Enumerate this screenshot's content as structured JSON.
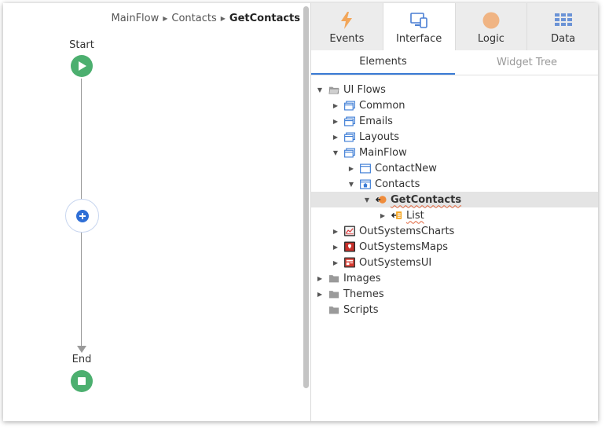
{
  "breadcrumb": {
    "items": [
      "MainFlow",
      "Contacts"
    ],
    "current": "GetContacts"
  },
  "flow": {
    "start_label": "Start",
    "end_label": "End"
  },
  "tabs": {
    "events": "Events",
    "interface": "Interface",
    "logic": "Logic",
    "data": "Data",
    "active": "Interface"
  },
  "subtabs": {
    "elements": "Elements",
    "widget_tree": "Widget Tree",
    "active": "Elements"
  },
  "tree": [
    {
      "label": "UI Flows",
      "depth": 0,
      "toggle": "expanded",
      "icon": "folder-open-icon"
    },
    {
      "label": "Common",
      "depth": 1,
      "toggle": "collapsed",
      "icon": "ui-flow-icon"
    },
    {
      "label": "Emails",
      "depth": 1,
      "toggle": "collapsed",
      "icon": "ui-flow-icon"
    },
    {
      "label": "Layouts",
      "depth": 1,
      "toggle": "collapsed",
      "icon": "ui-flow-icon"
    },
    {
      "label": "MainFlow",
      "depth": 1,
      "toggle": "expanded",
      "icon": "ui-flow-icon"
    },
    {
      "label": "ContactNew",
      "depth": 2,
      "toggle": "collapsed",
      "icon": "screen-icon"
    },
    {
      "label": "Contacts",
      "depth": 2,
      "toggle": "expanded",
      "icon": "home-screen-icon"
    },
    {
      "label": "GetContacts",
      "depth": 3,
      "toggle": "expanded",
      "icon": "data-action-icon",
      "selected": true
    },
    {
      "label": "List",
      "depth": 4,
      "toggle": "collapsed",
      "icon": "output-list-icon"
    },
    {
      "label": "OutSystemsCharts",
      "depth": 1,
      "toggle": "collapsed",
      "icon": "charts-module-icon"
    },
    {
      "label": "OutSystemsMaps",
      "depth": 1,
      "toggle": "collapsed",
      "icon": "maps-module-icon"
    },
    {
      "label": "OutSystemsUI",
      "depth": 1,
      "toggle": "collapsed",
      "icon": "ui-module-icon"
    },
    {
      "label": "Images",
      "depth": 0,
      "toggle": "collapsed",
      "icon": "folder-icon"
    },
    {
      "label": "Themes",
      "depth": 0,
      "toggle": "collapsed",
      "icon": "folder-icon"
    },
    {
      "label": "Scripts",
      "depth": 0,
      "toggle": "none",
      "icon": "folder-icon"
    }
  ],
  "colors": {
    "flow_green": "#4caf6f",
    "add_blue": "#2f6fd6",
    "tab_accent": "#3a7bd5",
    "lightning": "#f2a65a",
    "logic_orange": "#f0b483",
    "data_blue": "#6b93d6"
  }
}
